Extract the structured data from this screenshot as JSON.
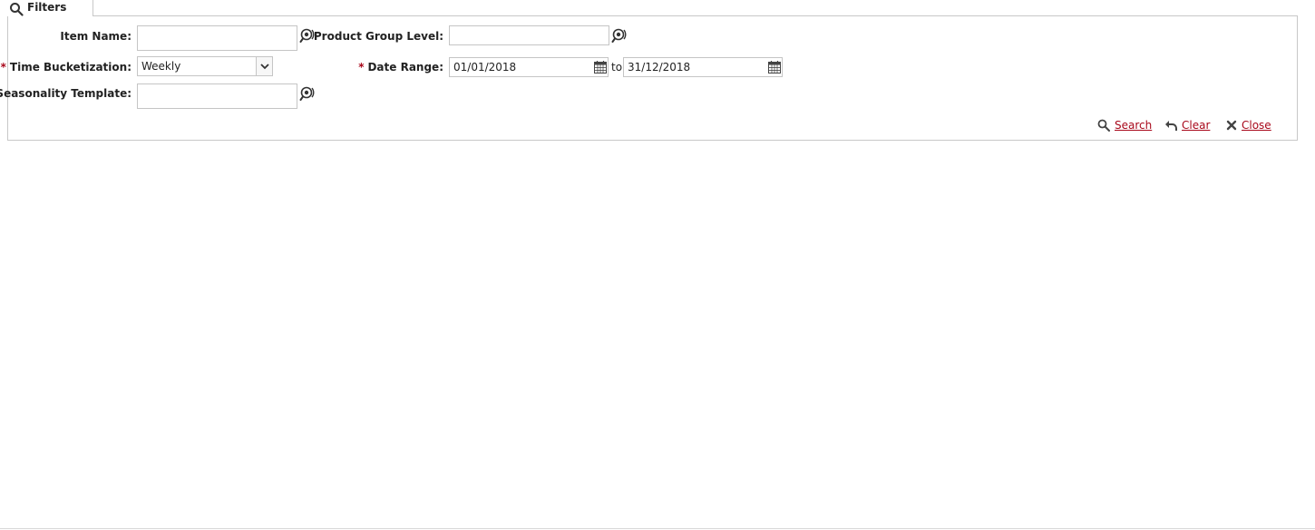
{
  "tab": {
    "label": "Filters",
    "icon": "search-icon"
  },
  "fields": {
    "item_name": {
      "label": "Item Name:",
      "value": "",
      "icon": "lookup-icon"
    },
    "product_group_level": {
      "label": "Product Group Level:",
      "value": "",
      "icon": "lookup-icon"
    },
    "time_bucketization": {
      "label": "Time Bucketization:",
      "required": "*",
      "selected": "Weekly"
    },
    "date_range": {
      "label": "Date Range:",
      "required": "*",
      "from": "01/01/2018",
      "to_label": "to",
      "to": "31/12/2018",
      "icon": "calendar-icon"
    },
    "seasonality_template": {
      "label": "Seasonality Template:",
      "required": "*",
      "value": "",
      "icon": "lookup-icon"
    }
  },
  "actions": {
    "search": {
      "label": "Search",
      "icon": "search-icon"
    },
    "clear": {
      "label": "Clear",
      "icon": "undo-arrow-icon"
    },
    "close": {
      "label": "Close",
      "icon": "close-icon"
    }
  },
  "colors": {
    "required": "#a8071a",
    "link": "#a8071a",
    "border": "#c8c8c8"
  }
}
